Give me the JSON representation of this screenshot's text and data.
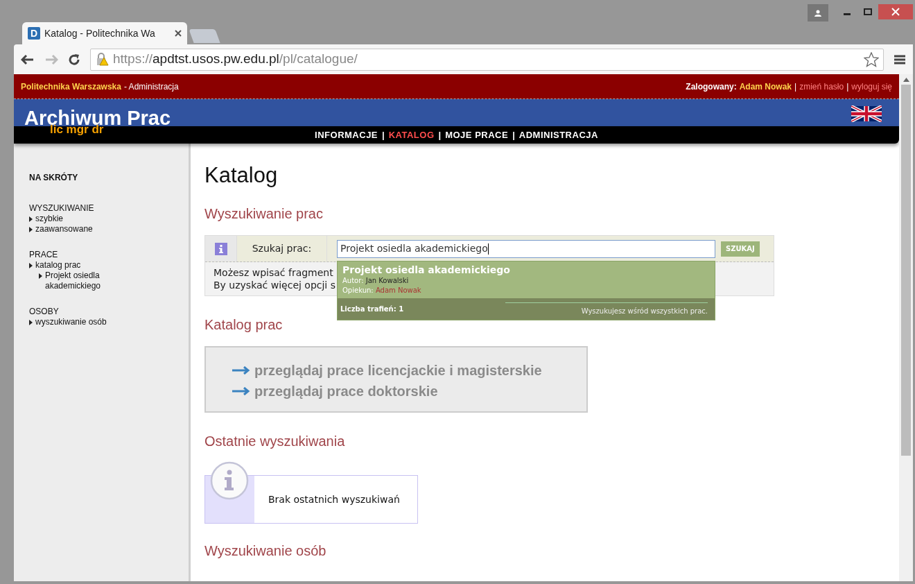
{
  "browser": {
    "tab": {
      "favicon": "D",
      "title": "Katalog - Politechnika Wa",
      "selected": true
    },
    "url": {
      "scheme": "https://",
      "host": "apdtst.usos.pw.edu.pl",
      "path": "/pl/catalogue/"
    }
  },
  "topbar": {
    "institution": "Politechnika Warszawska",
    "section": "- Administracja",
    "logged_label": "Zalogowany:",
    "user": "Adam Nowak",
    "separator": "|",
    "links": [
      "zmień hasło",
      "wyloguj się"
    ]
  },
  "logo": {
    "title": "Archiwum Prac",
    "subtitle": "lic mgr dr"
  },
  "nav_separator": "|",
  "nav": [
    {
      "label": "INFORMACJE",
      "selected": false
    },
    {
      "label": "KATALOG",
      "selected": true
    },
    {
      "label": "MOJE PRACE",
      "selected": false
    },
    {
      "label": "ADMINISTRACJA",
      "selected": false
    }
  ],
  "sidebar": {
    "title": "NA SKRÓTY",
    "sections": [
      {
        "heading": "WYSZUKIWANIE",
        "items": [
          {
            "label": "szybkie"
          },
          {
            "label": "zaawansowane"
          }
        ]
      },
      {
        "heading": "PRACE",
        "items": [
          {
            "label": "katalog prac",
            "children": [
              {
                "label": "Projekt osiedla akademickiego"
              }
            ]
          }
        ]
      },
      {
        "heading": "OSOBY",
        "items": [
          {
            "label": "wyszukiwanie osób"
          }
        ]
      }
    ]
  },
  "main": {
    "title": "Katalog",
    "search": {
      "heading": "Wyszukiwanie prac",
      "label": "Szukaj prac:",
      "value": "Projekt osiedla akademickiego",
      "button": "SZUKAJ",
      "hint": [
        "Możesz wpisać fragment",
        "By uzyskać więcej opcji s"
      ],
      "suggestion": {
        "title": "Projekt osiedla akademickiego",
        "author_label": "Autor:",
        "author": "Jan Kowalski",
        "supervisor_label": "Opiekun:",
        "supervisor": "Adam Nowak",
        "count": "Liczba trafień: 1",
        "scope": "Wyszukujesz wśród wszystkich prac."
      }
    },
    "catalog": {
      "heading": "Katalog prac",
      "links": [
        "przeglądaj prace licencjackie i magisterskie",
        "przeglądaj prace doktorskie"
      ]
    },
    "recent": {
      "heading": "Ostatnie wyszukiwania",
      "message": "Brak ostatnich wyszukiwań"
    },
    "people": {
      "heading": "Wyszukiwanie osób"
    }
  }
}
